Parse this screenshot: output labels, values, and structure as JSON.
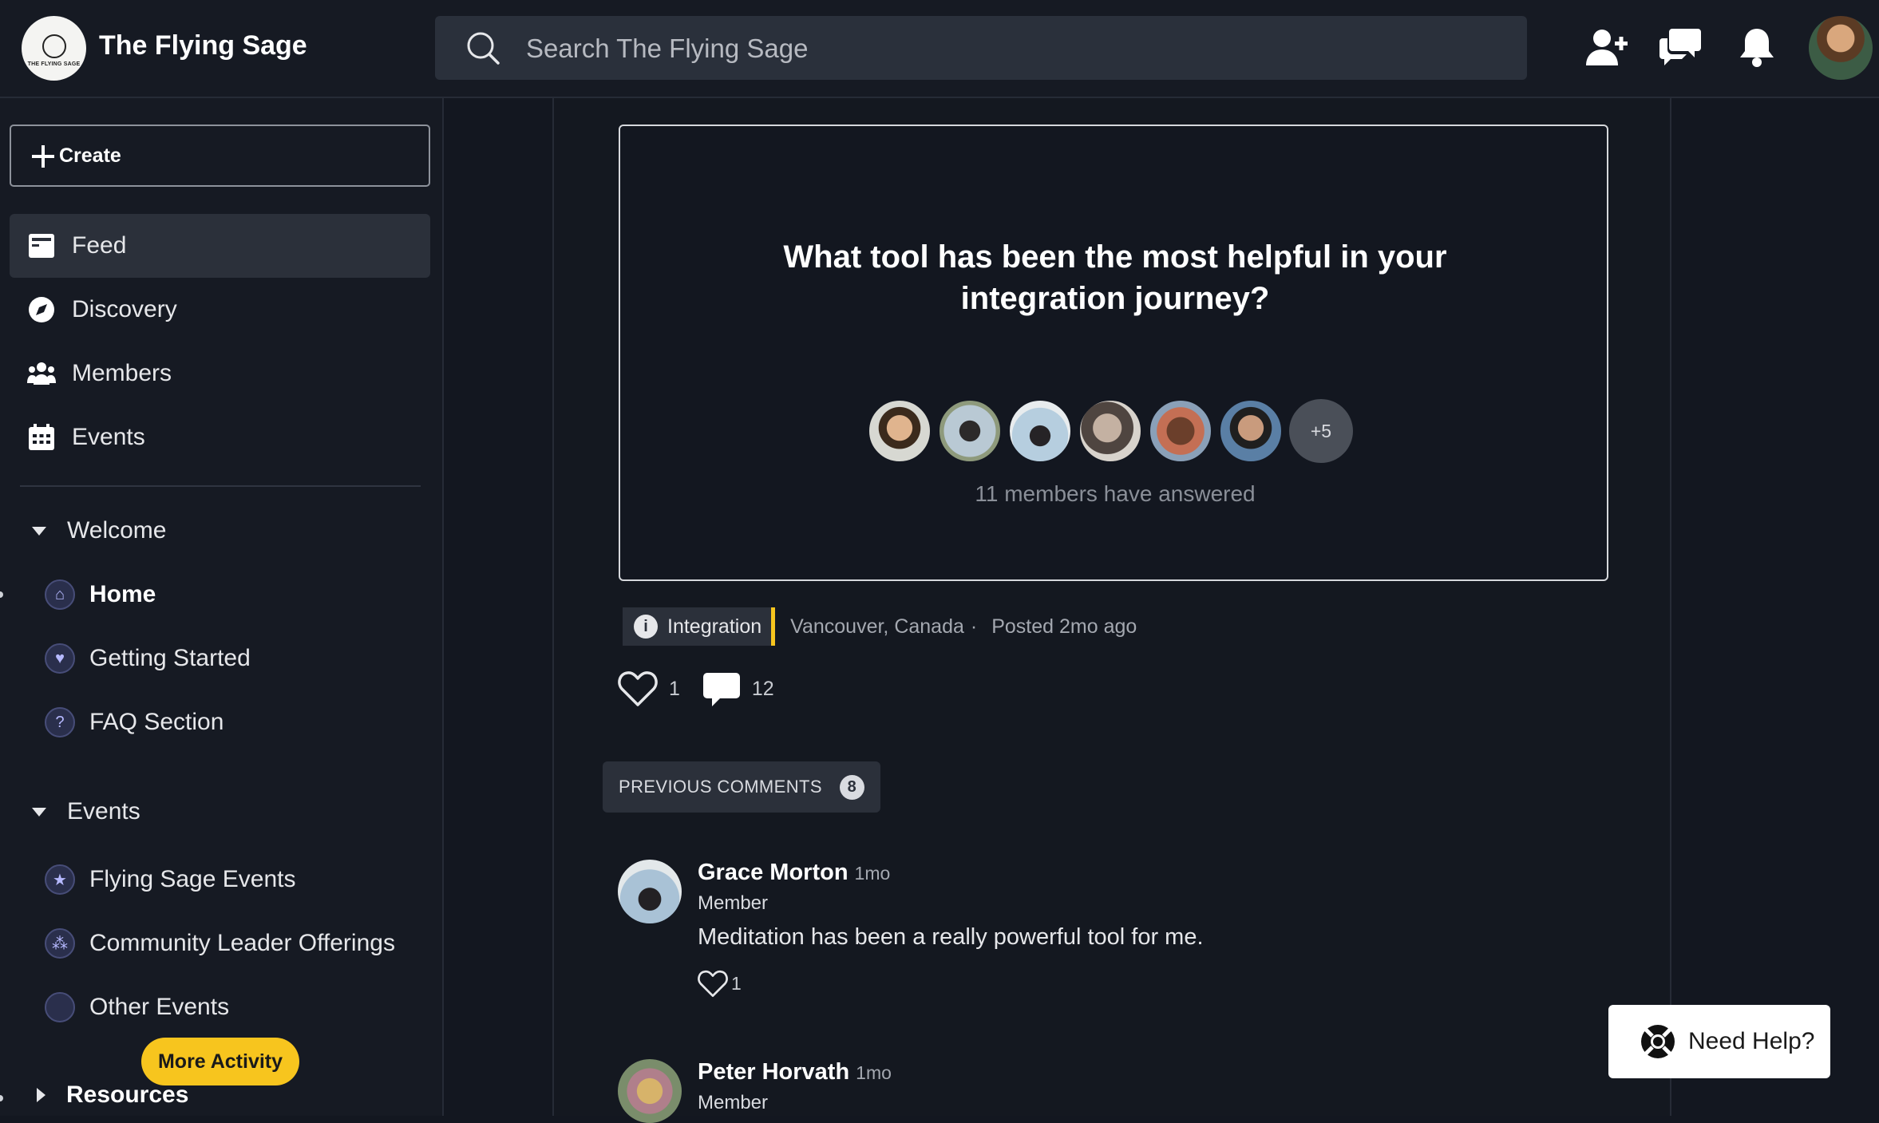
{
  "app": {
    "name": "The Flying Sage",
    "logo_text": "THE FLYING SAGE"
  },
  "search": {
    "placeholder": "Search The Flying Sage"
  },
  "topbar_icons": [
    "add-member-icon",
    "chat-icon",
    "bell-icon"
  ],
  "sidebar": {
    "create_label": "Create",
    "nav": [
      {
        "label": "Feed",
        "icon": "feed-icon",
        "active": true
      },
      {
        "label": "Discovery",
        "icon": "compass-icon"
      },
      {
        "label": "Members",
        "icon": "members-icon"
      },
      {
        "label": "Events",
        "icon": "calendar-icon"
      }
    ],
    "sections": [
      {
        "title": "Welcome",
        "items": [
          {
            "label": "Home",
            "icon": "home-icon"
          },
          {
            "label": "Getting Started",
            "icon": "heart-icon"
          },
          {
            "label": "FAQ Section",
            "icon": "question-icon"
          }
        ]
      },
      {
        "title": "Events",
        "items": [
          {
            "label": "Flying Sage Events",
            "icon": "star-icon"
          },
          {
            "label": "Community Leader Offerings",
            "icon": "group-icon"
          },
          {
            "label": "Other Events",
            "icon": "circle-icon"
          }
        ]
      },
      {
        "title": "Resources",
        "items": []
      }
    ],
    "more_activity_label": "More Activity"
  },
  "post": {
    "question": "What tool has been the most helpful in your integration journey?",
    "answer_more": "+5",
    "answered_text": "11 members have answered",
    "tag": "Integration",
    "location": "Vancouver, Canada",
    "posted": "Posted 2mo ago",
    "likes": "1",
    "comments": "12"
  },
  "previous_comments": {
    "label": "PREVIOUS COMMENTS",
    "count": "8"
  },
  "comments": [
    {
      "name": "Grace Morton",
      "time": "1mo",
      "role": "Member",
      "text": "Meditation has been a really powerful tool for me.",
      "likes": "1"
    },
    {
      "name": "Peter Horvath",
      "time": "1mo",
      "role": "Member"
    }
  ],
  "help": {
    "label": "Need Help?"
  },
  "colors": {
    "background": "#131720",
    "panel": "#161a23",
    "accent": "#f7c51e",
    "active_nav": "#2b303a"
  }
}
